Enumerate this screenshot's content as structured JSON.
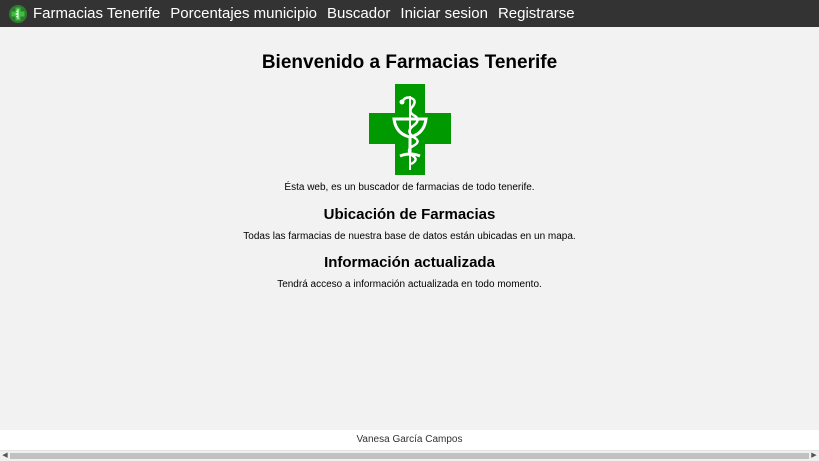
{
  "nav": {
    "brand": "Farmacias Tenerife",
    "links": [
      "Porcentajes municipio",
      "Buscador",
      "Iniciar sesion",
      "Registrarse"
    ]
  },
  "main": {
    "title": "Bienvenido a Farmacias Tenerife",
    "intro": "Ésta web, es un buscador de farmacias de todo tenerife.",
    "section1_title": "Ubicación de Farmacias",
    "section1_text": "Todas las farmacias de nuestra base de datos están ubicadas en un mapa.",
    "section2_title": "Información actualizada",
    "section2_text": "Tendrá acceso a información actualizada en todo momento."
  },
  "footer": {
    "author": "Vanesa García Campos"
  },
  "colors": {
    "navbar": "#333333",
    "pharmacy_green": "#009900",
    "background": "#f2f2f2"
  },
  "icons": {
    "logo": "pharmacy-cross-icon",
    "hero": "pharmacy-cross-icon"
  }
}
